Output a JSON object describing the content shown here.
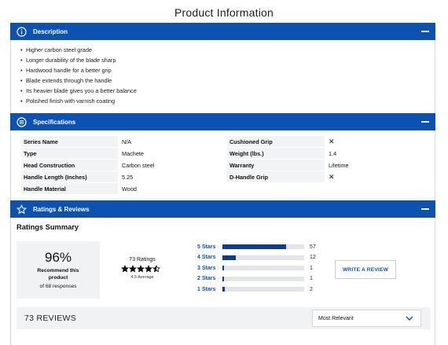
{
  "page_title": "Product Information",
  "description": {
    "title": "Description",
    "icon": "info-icon",
    "items": [
      "Higher carbon steel grade",
      "Longer durability of the blade sharp",
      "Hardwood handle for a better grip",
      "Blade extends through the handle",
      "Its heavier blade gives you a better balance",
      "Polished finish with varnish coating"
    ]
  },
  "specifications": {
    "title": "Specifications",
    "icon": "list-icon",
    "left": [
      {
        "label": "Series Name",
        "value": "N/A"
      },
      {
        "label": "Type",
        "value": "Machete"
      },
      {
        "label": "Head Construction",
        "value": "Carbon steel"
      },
      {
        "label": "Handle Length (Inches)",
        "value": "5.25"
      },
      {
        "label": "Handle Material",
        "value": "Wood"
      }
    ],
    "right": [
      {
        "label": "Cushioned Grip",
        "value": "✕"
      },
      {
        "label": "Weight (lbs.)",
        "value": "1.4"
      },
      {
        "label": "Warranty",
        "value": "Lifetime"
      },
      {
        "label": "D-Handle Grip",
        "value": "✕"
      }
    ]
  },
  "ratings": {
    "title": "Ratings & Reviews",
    "icon": "star-outline-icon",
    "summary_title": "Ratings Summary",
    "recommend_percent": "96%",
    "recommend_label": "Recommend this product",
    "recommend_responses": "of 68 responses",
    "ratings_count": "73 Ratings",
    "average_rating": 4.5,
    "average_label": "4.5 Average",
    "histogram": [
      {
        "label": "5 Stars",
        "count": "57",
        "fraction": 0.78
      },
      {
        "label": "4 Stars",
        "count": "12",
        "fraction": 0.16
      },
      {
        "label": "3 Stars",
        "count": "1",
        "fraction": 0.015
      },
      {
        "label": "2 Stars",
        "count": "1",
        "fraction": 0.015
      },
      {
        "label": "1 Stars",
        "count": "2",
        "fraction": 0.03
      }
    ],
    "write_review_label": "WRITE A REVIEW",
    "reviews_count_label": "73 REVIEWS",
    "sort_selected": "Most Relevant"
  },
  "colors": {
    "accent": "#0b52b3",
    "bar_fill": "#0b3c9a",
    "panel_bg": "#f1f2f4"
  }
}
